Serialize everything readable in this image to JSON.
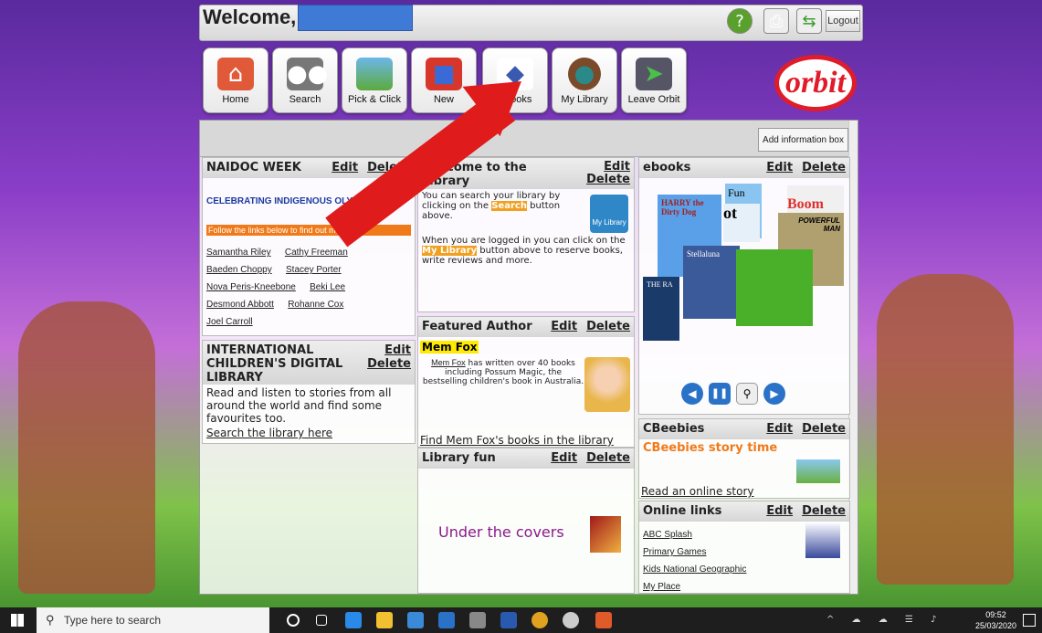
{
  "header": {
    "welcome": "Welcome,",
    "logout": "Logout"
  },
  "nav": [
    {
      "label": "Home",
      "icon": "house-icon"
    },
    {
      "label": "Search",
      "icon": "binoculars-icon"
    },
    {
      "label": "Pick & Click",
      "icon": "picture-icon"
    },
    {
      "label": "New",
      "icon": "gift-icon"
    },
    {
      "label": "eBooks",
      "icon": "ebook-icon"
    },
    {
      "label": "My Library",
      "icon": "avatar-icon"
    },
    {
      "label": "Leave Orbit",
      "icon": "door-exit-icon"
    }
  ],
  "logo": "orbit",
  "infobar": {
    "add": "Add information box"
  },
  "panel_actions": {
    "edit": "Edit",
    "delete": "Delete"
  },
  "naidoc": {
    "title": "NAIDOC WEEK",
    "banner": "CELEBRATING INDIGENOUS OLYMPIANS!",
    "follow": "Follow the links below to find out more.",
    "links": [
      "Samantha Riley",
      "Cathy Freeman",
      "Baeden Choppy",
      "Stacey Porter",
      "Nova Peris-Kneebone",
      "Beki Lee",
      "Desmond Abbott",
      "Rohanne Cox",
      "Joel Carroll"
    ]
  },
  "icdl": {
    "title": "INTERNATIONAL CHILDREN'S DIGITAL LIBRARY",
    "body": "Read and listen to stories from all around the world and find some favourites too.",
    "link": "Search the library here"
  },
  "welcomepanel": {
    "title": "Welcome to the Library",
    "p1a": "You can search your library by clicking on the",
    "p1h": "Search",
    "p1b": "button above.",
    "p2a": "When you are logged in you can click on the",
    "p2h": "My Library",
    "p2b": "button above to reserve books, write reviews and more.",
    "badge": "My Library"
  },
  "featured": {
    "title": "Featured Author",
    "name": "Mem Fox",
    "link": "Mem Fox",
    "body": "has written over 40 books including Possum Magic, the bestselling children's book in Australia.",
    "find": "Find Mem Fox's books in the library"
  },
  "fun": {
    "title": "Library fun",
    "text": "Under the covers"
  },
  "ebooks": {
    "title": "ebooks",
    "covers": [
      "HARRY the Dirty Dog",
      "Fun",
      "ot",
      "Boom",
      "POWERFUL MAN",
      "Stellaluna",
      "THE RA"
    ]
  },
  "cbeebies": {
    "title": "CBeebies",
    "subtitle": "CBeebies story time",
    "link": "Read an online story"
  },
  "online": {
    "title": "Online links",
    "links": [
      "ABC Splash",
      "Primary Games",
      "Kids National Geographic",
      "My Place"
    ]
  },
  "taskbar": {
    "search": "Type here to search",
    "time": "09:52",
    "date": "25/03/2020"
  }
}
